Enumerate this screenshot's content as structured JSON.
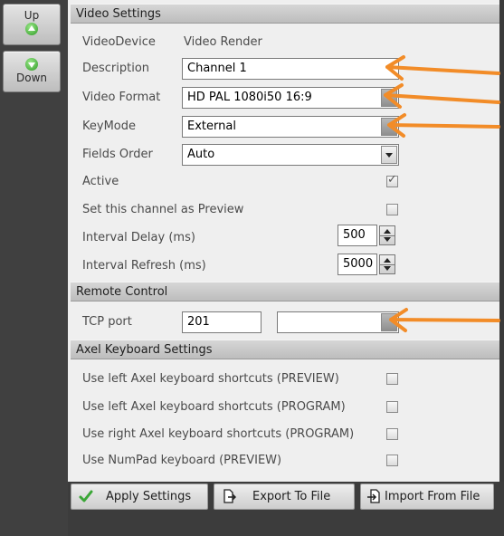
{
  "sidebar": {
    "up_label": "Up",
    "down_label": "Down"
  },
  "video_settings": {
    "header": "Video Settings",
    "video_device_label": "VideoDevice",
    "video_device_value": "Video Render",
    "description_label": "Description",
    "description_value": "Channel 1",
    "video_format_label": "Video Format",
    "video_format_value": "HD PAL 1080i50 16:9",
    "keymode_label": "KeyMode",
    "keymode_value": "External",
    "fields_order_label": "Fields Order",
    "fields_order_value": "Auto",
    "active_label": "Active",
    "active_checked": true,
    "preview_label": "Set this channel as Preview",
    "preview_checked": false,
    "interval_delay_label": "Interval Delay (ms)",
    "interval_delay_value": "500",
    "interval_refresh_label": "Interval Refresh (ms)",
    "interval_refresh_value": "5000"
  },
  "remote_control": {
    "header": "Remote Control",
    "tcp_port_label": "TCP port",
    "tcp_port_value": "201",
    "extra_value": ""
  },
  "axel_keyboard": {
    "header": "Axel Keyboard Settings",
    "items": [
      {
        "label": "Use left Axel keyboard shortcuts (PREVIEW)",
        "checked": false
      },
      {
        "label": "Use left Axel keyboard shortcuts (PROGRAM)",
        "checked": false
      },
      {
        "label": "Use right Axel keyboard shortcuts (PROGRAM)",
        "checked": false
      },
      {
        "label": "Use NumPad keyboard (PREVIEW)",
        "checked": false
      }
    ]
  },
  "actions": {
    "apply": "Apply Settings",
    "export": "Export To File",
    "import": "Import From File"
  },
  "colors": {
    "arrow": "#f28c28",
    "check_green": "#3aa636"
  }
}
